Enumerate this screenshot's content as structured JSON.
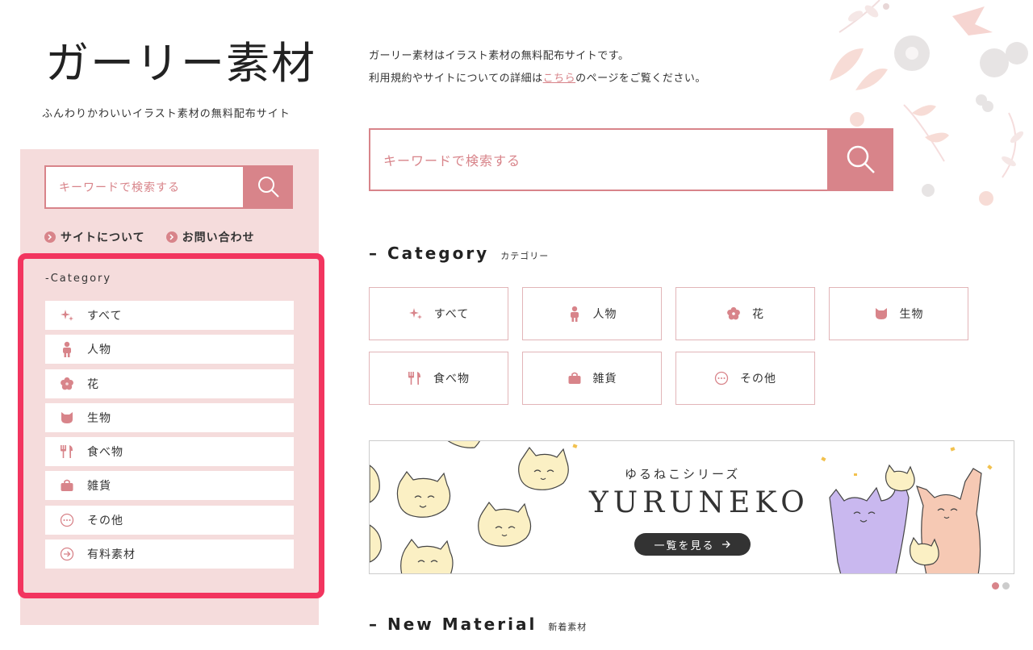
{
  "header": {
    "logo": "ガーリー素材",
    "tagline": "ふんわりかわいいイラスト素材の無料配布サイト"
  },
  "sidebar": {
    "search_placeholder": "キーワードで検索する",
    "links": [
      {
        "label": "サイトについて"
      },
      {
        "label": "お問い合わせ"
      }
    ],
    "category_title": "-Category",
    "items": [
      {
        "label": "すべて",
        "icon": "sparkle-icon"
      },
      {
        "label": "人物",
        "icon": "person-icon"
      },
      {
        "label": "花",
        "icon": "flower-icon"
      },
      {
        "label": "生物",
        "icon": "cat-icon"
      },
      {
        "label": "食べ物",
        "icon": "fork-icon"
      },
      {
        "label": "雑貨",
        "icon": "bag-icon"
      },
      {
        "label": "その他",
        "icon": "dots-icon"
      },
      {
        "label": "有料素材",
        "icon": "arrow-circle-icon"
      }
    ]
  },
  "main": {
    "intro_line1": "ガーリー素材はイラスト素材の無料配布サイトです。",
    "intro_line2_pre": "利用規約やサイトについての詳細は",
    "intro_link": "こちら",
    "intro_line2_post": "のページをご覧ください。",
    "search_placeholder": "キーワードで検索する",
    "category_section": {
      "en": "– Category",
      "jp": "カテゴリー"
    },
    "categories": [
      {
        "label": "すべて",
        "icon": "sparkle-icon"
      },
      {
        "label": "人物",
        "icon": "person-icon"
      },
      {
        "label": "花",
        "icon": "flower-icon"
      },
      {
        "label": "生物",
        "icon": "cat-icon"
      },
      {
        "label": "食べ物",
        "icon": "fork-icon"
      },
      {
        "label": "雑貨",
        "icon": "bag-icon"
      },
      {
        "label": "その他",
        "icon": "dots-icon"
      }
    ],
    "banner": {
      "subtitle": "ゆるねこシリーズ",
      "title": "YURUNEKO",
      "button": "一覧を見る"
    },
    "carousel": {
      "current": 1,
      "total": 2
    },
    "new_section": {
      "en": "– New Material",
      "jp": "新着素材"
    }
  },
  "colors": {
    "accent": "#d8848a",
    "sidebar_bg": "#f5dcdc",
    "highlight_frame": "#f2355f"
  }
}
